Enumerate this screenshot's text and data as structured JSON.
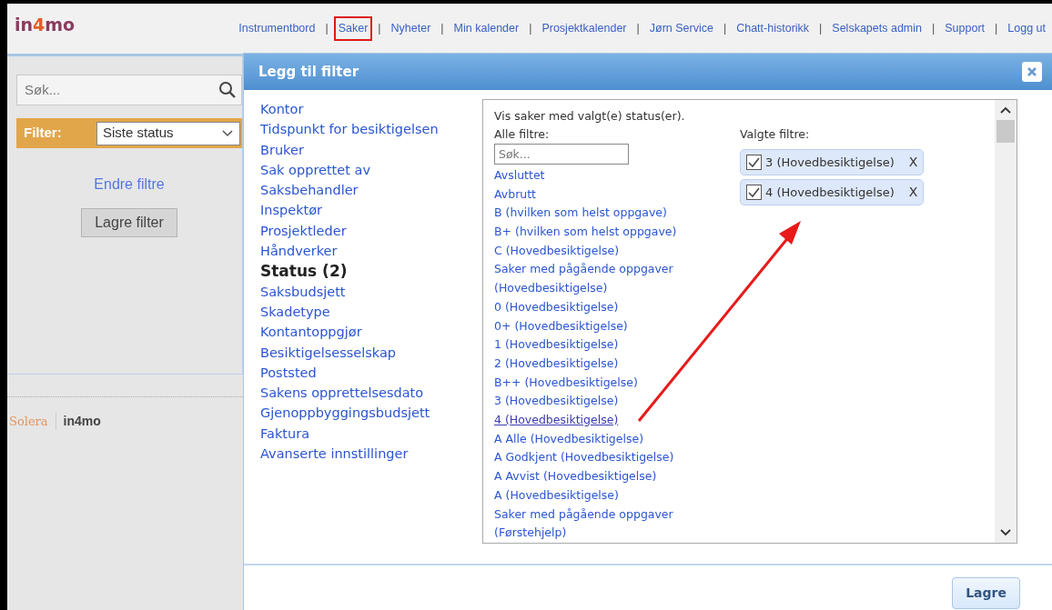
{
  "header": {
    "logo": {
      "part1": "in",
      "part2": "4",
      "part3": "mo"
    },
    "separator": "|",
    "nav": [
      {
        "label": "Instrumentbord",
        "highlighted": false
      },
      {
        "label": "Saker",
        "highlighted": true
      },
      {
        "label": "Nyheter",
        "highlighted": false
      },
      {
        "label": "Min kalender",
        "highlighted": false
      },
      {
        "label": "Prosjektkalender",
        "highlighted": false
      },
      {
        "label": "Jørn Service",
        "highlighted": false
      },
      {
        "label": "Chatt-historikk",
        "highlighted": false
      },
      {
        "label": "Selskapets admin",
        "highlighted": false
      },
      {
        "label": "Support",
        "highlighted": false
      },
      {
        "label": "Logg ut",
        "highlighted": false
      }
    ]
  },
  "sidebar": {
    "search": {
      "placeholder": "Søk..."
    },
    "filter": {
      "label": "Filter:",
      "value": "Siste status"
    },
    "change_link": "Endre filtre",
    "save_button": "Lagre filter",
    "footer": {
      "brand": "Solera",
      "product": "in4mo"
    }
  },
  "dialog": {
    "title": "Legg til filter",
    "categories": [
      {
        "label": "Kontor",
        "selected": false
      },
      {
        "label": "Tidspunkt for besiktigelsen",
        "selected": false
      },
      {
        "label": "Bruker",
        "selected": false
      },
      {
        "label": "Sak opprettet av",
        "selected": false
      },
      {
        "label": "Saksbehandler",
        "selected": false
      },
      {
        "label": "Inspektør",
        "selected": false
      },
      {
        "label": "Prosjektleder",
        "selected": false
      },
      {
        "label": "Håndverker",
        "selected": false
      },
      {
        "label": "Status (2)",
        "selected": true
      },
      {
        "label": "Saksbudsjett",
        "selected": false
      },
      {
        "label": "Skadetype",
        "selected": false
      },
      {
        "label": "Kontantoppgjør",
        "selected": false
      },
      {
        "label": "Besiktigelsesselskap",
        "selected": false
      },
      {
        "label": "Poststed",
        "selected": false
      },
      {
        "label": "Sakens opprettelsesdato",
        "selected": false
      },
      {
        "label": "Gjenoppbyggingsbudsjett",
        "selected": false
      },
      {
        "label": "Faktura",
        "selected": false
      },
      {
        "label": "Avanserte innstillinger",
        "selected": false
      }
    ],
    "intro": "Vis saker med valgt(e) status(er).",
    "all_label": "Alle filtre:",
    "search": {
      "placeholder": "Søk..."
    },
    "options": [
      {
        "label": "Avsluttet",
        "hovered": false
      },
      {
        "label": "Avbrutt",
        "hovered": false
      },
      {
        "label": "B (hvilken som helst oppgave)",
        "hovered": false
      },
      {
        "label": "B+ (hvilken som helst oppgave)",
        "hovered": false
      },
      {
        "label": "C (Hovedbesiktigelse)",
        "hovered": false
      },
      {
        "label": "Saker med pågående oppgaver (Hovedbesiktigelse)",
        "hovered": false
      },
      {
        "label": "0 (Hovedbesiktigelse)",
        "hovered": false
      },
      {
        "label": "0+ (Hovedbesiktigelse)",
        "hovered": false
      },
      {
        "label": "1 (Hovedbesiktigelse)",
        "hovered": false
      },
      {
        "label": "2 (Hovedbesiktigelse)",
        "hovered": false
      },
      {
        "label": "B++ (Hovedbesiktigelse)",
        "hovered": false
      },
      {
        "label": "3 (Hovedbesiktigelse)",
        "hovered": false
      },
      {
        "label": "4 (Hovedbesiktigelse)",
        "hovered": true
      },
      {
        "label": "A Alle (Hovedbesiktigelse)",
        "hovered": false
      },
      {
        "label": "A Godkjent (Hovedbesiktigelse)",
        "hovered": false
      },
      {
        "label": "A Avvist (Hovedbesiktigelse)",
        "hovered": false
      },
      {
        "label": "A (Hovedbesiktigelse)",
        "hovered": false
      },
      {
        "label": "Saker med pågående oppgaver (Førstehjelp)",
        "hovered": false
      }
    ],
    "selected_label": "Valgte filtre:",
    "selected_filters": [
      {
        "label": "3 (Hovedbesiktigelse)",
        "checked": true,
        "remove": "X"
      },
      {
        "label": "4 (Hovedbesiktigelse)",
        "checked": true,
        "remove": "X"
      }
    ],
    "save_button": "Lagre"
  },
  "annotations": [
    {
      "kind": "arrow"
    }
  ]
}
